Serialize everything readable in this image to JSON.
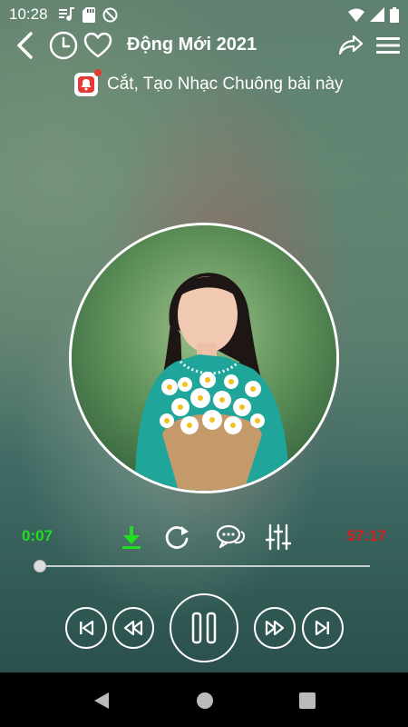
{
  "status_bar": {
    "time": "10:28",
    "icons": [
      "playlist-music-icon",
      "sd-card-icon",
      "at-sign-icon",
      "wifi-icon",
      "signal-icon",
      "battery-icon"
    ]
  },
  "toolbar": {
    "title": "Động Mới 2021",
    "icons": [
      "back-arrow-icon",
      "history-clock-icon",
      "heart-icon",
      "share-icon",
      "menu-icon"
    ]
  },
  "ringtone_banner": {
    "label": "Cắt, Tạo Nhạc Chuông bài này",
    "icon": "ringtone-cut-icon"
  },
  "player": {
    "elapsed": "0:07",
    "total": "57:17",
    "progress": 0.0,
    "colors": {
      "elapsed": "#22dd22",
      "total": "#d42020",
      "download": "#22dd22"
    },
    "actions": [
      "download-icon",
      "repeat-icon",
      "comment-icon",
      "equalizer-icon"
    ],
    "transport": [
      "previous-icon",
      "rewind-icon",
      "pause-icon",
      "fast-forward-icon",
      "next-icon"
    ]
  },
  "nav_bar": {
    "icons": [
      "back-triangle-icon",
      "home-circle-icon",
      "recents-square-icon"
    ]
  }
}
